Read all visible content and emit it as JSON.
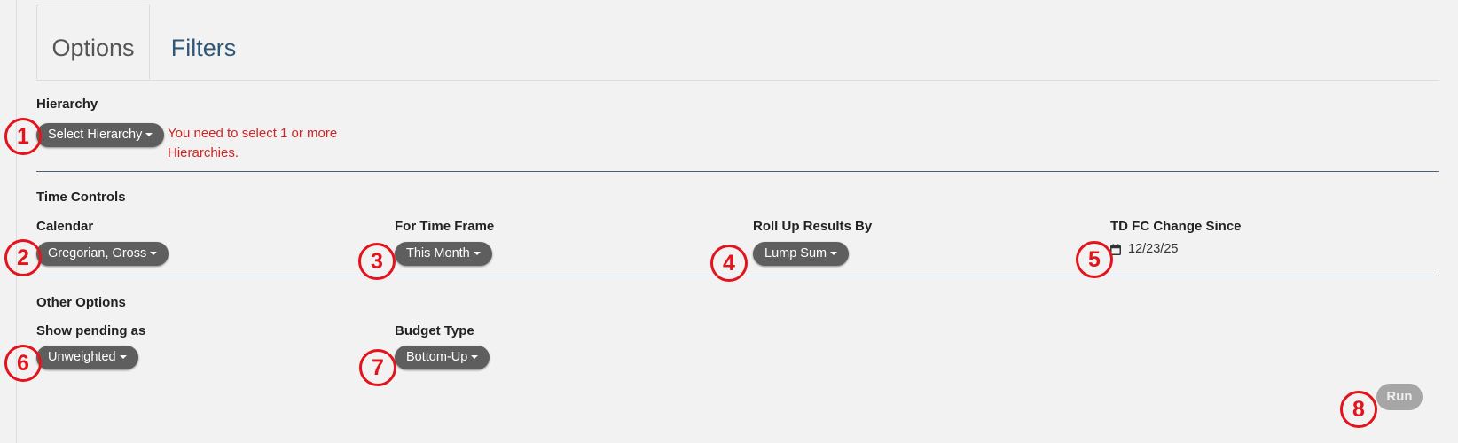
{
  "tabs": [
    {
      "label": "Options",
      "active": true
    },
    {
      "label": "Filters",
      "active": false
    }
  ],
  "hierarchy": {
    "section_title": "Hierarchy",
    "dropdown_label": "Select Hierarchy",
    "error_message": "You need to select 1 or more Hierarchies."
  },
  "time_controls": {
    "section_title": "Time Controls",
    "calendar": {
      "label": "Calendar",
      "value": "Gregorian, Gross"
    },
    "time_frame": {
      "label": "For Time Frame",
      "value": "This Month"
    },
    "roll_up": {
      "label": "Roll Up Results By",
      "value": "Lump Sum"
    },
    "td_fc_change": {
      "label": "TD FC Change Since",
      "value": "12/23/25"
    }
  },
  "other_options": {
    "section_title": "Other Options",
    "show_pending": {
      "label": "Show pending as",
      "value": "Unweighted"
    },
    "budget_type": {
      "label": "Budget Type",
      "value": "Bottom-Up"
    }
  },
  "run_button": {
    "label": "Run"
  },
  "annotation_markers": [
    "1",
    "2",
    "3",
    "4",
    "5",
    "6",
    "7",
    "8"
  ],
  "colors": {
    "background": "#f2f2f2",
    "pill_button": "#5e5e5e",
    "error_text": "#d02424",
    "divider": "#4d5f74",
    "run_button_disabled": "#a6a6a6",
    "annotation_red": "#e3141c",
    "tab_link": "#2f5878"
  },
  "icons": {
    "date_field": "calendar-icon",
    "dropdown": "caret-down-icon"
  }
}
